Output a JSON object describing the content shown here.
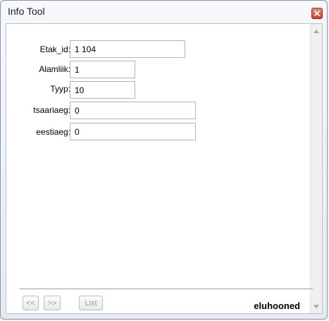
{
  "window": {
    "title": "Info Tool",
    "close_icon": "close-icon"
  },
  "fields": [
    {
      "label": "Etak_id:",
      "value": "1 104"
    },
    {
      "label": "Alamliik:",
      "value": "1"
    },
    {
      "label": "Tyyp:",
      "value": "10"
    },
    {
      "label": "tsaariaeg:",
      "value": "0"
    },
    {
      "label": "eestiaeg:",
      "value": "0"
    }
  ],
  "footer": {
    "prev_label": "<<",
    "next_label": ">>",
    "list_label": "List",
    "layer_name": "eluhooned"
  },
  "colors": {
    "close_button": "#c8402c",
    "content_bg": "#ffffff"
  }
}
